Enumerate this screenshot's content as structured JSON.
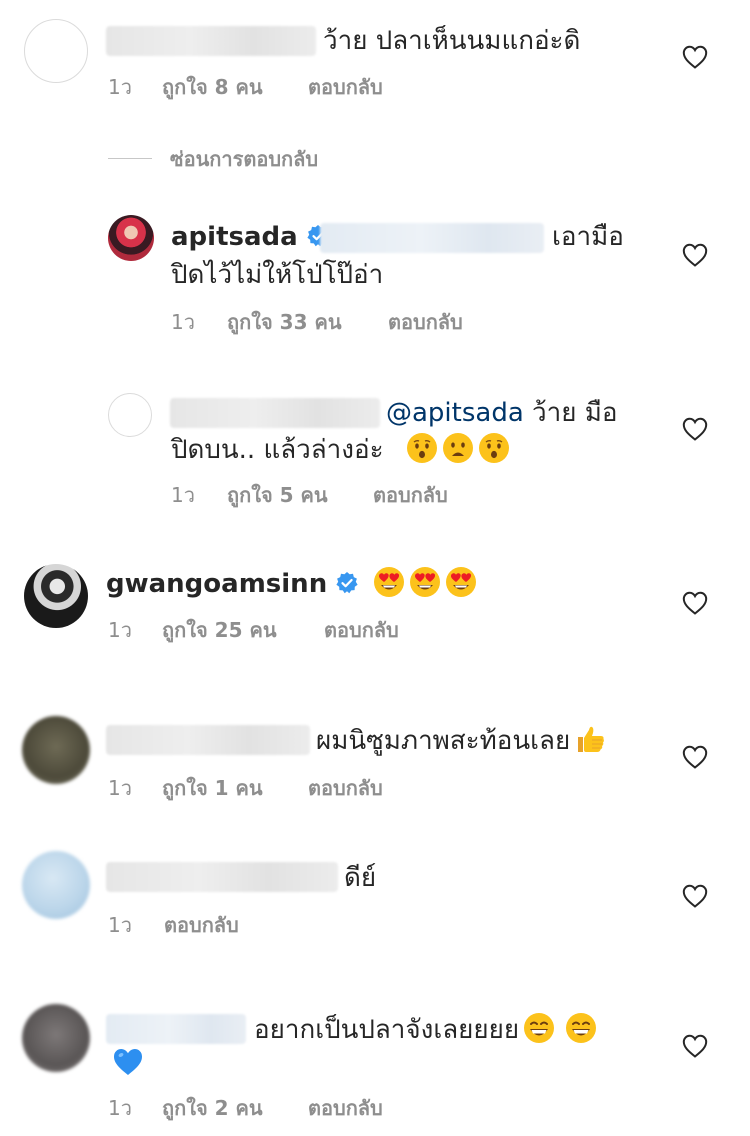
{
  "comments": [
    {
      "text": "ว้าย ปลาเห็นนมแกอ่ะดิ",
      "time": "1ว",
      "likes": "ถูกใจ 8 คน",
      "reply": "ตอบกลับ"
    },
    {
      "hide_replies": "ซ่อนการตอบกลับ"
    },
    {
      "username": "apitsada",
      "line1": "เอามือ",
      "line2": "ปิดไว้ไม่ให้โป่โป๊อ่า",
      "time": "1ว",
      "likes": "ถูกใจ 33 คน",
      "reply": "ตอบกลับ"
    },
    {
      "mention": "@apitsada",
      "line1": "ว้าย มือ",
      "line2": "ปิดบน.. แล้วล่างอ่ะ",
      "emojis": [
        "hushed-face",
        "frowning-face",
        "hushed-face"
      ],
      "time": "1ว",
      "likes": "ถูกใจ 5 คน",
      "reply": "ตอบกลับ"
    },
    {
      "username": "gwangoamsinn",
      "emojis": [
        "heart-eyes",
        "heart-eyes",
        "heart-eyes"
      ],
      "time": "1ว",
      "likes": "ถูกใจ 25 คน",
      "reply": "ตอบกลับ"
    },
    {
      "text": "ผมนิซูมภาพสะท้อนเลย",
      "emojis": [
        "thumbs-up"
      ],
      "time": "1ว",
      "likes": "ถูกใจ 1 คน",
      "reply": "ตอบกลับ"
    },
    {
      "text": "ดีย์",
      "time": "1ว",
      "reply": "ตอบกลับ"
    },
    {
      "text": "อยากเป็นปลาจังเลยยยย",
      "emojis": [
        "grinning-face",
        "grinning-face",
        "blue-heart"
      ],
      "time": "1ว",
      "likes": "ถูกใจ 2 คน",
      "reply": "ตอบกลับ"
    }
  ],
  "colors": {
    "text": "#262626",
    "meta": "#8e8e8e",
    "mention": "#003569",
    "verified": "#3897f0"
  }
}
